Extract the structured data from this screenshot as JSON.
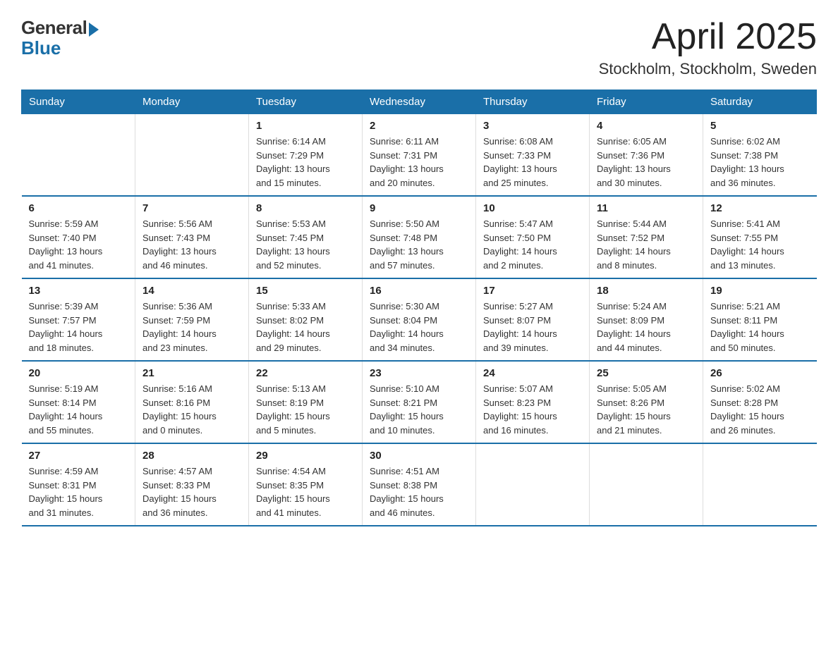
{
  "header": {
    "logo_general": "General",
    "logo_blue": "Blue",
    "month_title": "April 2025",
    "location": "Stockholm, Stockholm, Sweden"
  },
  "days_of_week": [
    "Sunday",
    "Monday",
    "Tuesday",
    "Wednesday",
    "Thursday",
    "Friday",
    "Saturday"
  ],
  "weeks": [
    [
      {
        "day": "",
        "info": ""
      },
      {
        "day": "",
        "info": ""
      },
      {
        "day": "1",
        "info": "Sunrise: 6:14 AM\nSunset: 7:29 PM\nDaylight: 13 hours\nand 15 minutes."
      },
      {
        "day": "2",
        "info": "Sunrise: 6:11 AM\nSunset: 7:31 PM\nDaylight: 13 hours\nand 20 minutes."
      },
      {
        "day": "3",
        "info": "Sunrise: 6:08 AM\nSunset: 7:33 PM\nDaylight: 13 hours\nand 25 minutes."
      },
      {
        "day": "4",
        "info": "Sunrise: 6:05 AM\nSunset: 7:36 PM\nDaylight: 13 hours\nand 30 minutes."
      },
      {
        "day": "5",
        "info": "Sunrise: 6:02 AM\nSunset: 7:38 PM\nDaylight: 13 hours\nand 36 minutes."
      }
    ],
    [
      {
        "day": "6",
        "info": "Sunrise: 5:59 AM\nSunset: 7:40 PM\nDaylight: 13 hours\nand 41 minutes."
      },
      {
        "day": "7",
        "info": "Sunrise: 5:56 AM\nSunset: 7:43 PM\nDaylight: 13 hours\nand 46 minutes."
      },
      {
        "day": "8",
        "info": "Sunrise: 5:53 AM\nSunset: 7:45 PM\nDaylight: 13 hours\nand 52 minutes."
      },
      {
        "day": "9",
        "info": "Sunrise: 5:50 AM\nSunset: 7:48 PM\nDaylight: 13 hours\nand 57 minutes."
      },
      {
        "day": "10",
        "info": "Sunrise: 5:47 AM\nSunset: 7:50 PM\nDaylight: 14 hours\nand 2 minutes."
      },
      {
        "day": "11",
        "info": "Sunrise: 5:44 AM\nSunset: 7:52 PM\nDaylight: 14 hours\nand 8 minutes."
      },
      {
        "day": "12",
        "info": "Sunrise: 5:41 AM\nSunset: 7:55 PM\nDaylight: 14 hours\nand 13 minutes."
      }
    ],
    [
      {
        "day": "13",
        "info": "Sunrise: 5:39 AM\nSunset: 7:57 PM\nDaylight: 14 hours\nand 18 minutes."
      },
      {
        "day": "14",
        "info": "Sunrise: 5:36 AM\nSunset: 7:59 PM\nDaylight: 14 hours\nand 23 minutes."
      },
      {
        "day": "15",
        "info": "Sunrise: 5:33 AM\nSunset: 8:02 PM\nDaylight: 14 hours\nand 29 minutes."
      },
      {
        "day": "16",
        "info": "Sunrise: 5:30 AM\nSunset: 8:04 PM\nDaylight: 14 hours\nand 34 minutes."
      },
      {
        "day": "17",
        "info": "Sunrise: 5:27 AM\nSunset: 8:07 PM\nDaylight: 14 hours\nand 39 minutes."
      },
      {
        "day": "18",
        "info": "Sunrise: 5:24 AM\nSunset: 8:09 PM\nDaylight: 14 hours\nand 44 minutes."
      },
      {
        "day": "19",
        "info": "Sunrise: 5:21 AM\nSunset: 8:11 PM\nDaylight: 14 hours\nand 50 minutes."
      }
    ],
    [
      {
        "day": "20",
        "info": "Sunrise: 5:19 AM\nSunset: 8:14 PM\nDaylight: 14 hours\nand 55 minutes."
      },
      {
        "day": "21",
        "info": "Sunrise: 5:16 AM\nSunset: 8:16 PM\nDaylight: 15 hours\nand 0 minutes."
      },
      {
        "day": "22",
        "info": "Sunrise: 5:13 AM\nSunset: 8:19 PM\nDaylight: 15 hours\nand 5 minutes."
      },
      {
        "day": "23",
        "info": "Sunrise: 5:10 AM\nSunset: 8:21 PM\nDaylight: 15 hours\nand 10 minutes."
      },
      {
        "day": "24",
        "info": "Sunrise: 5:07 AM\nSunset: 8:23 PM\nDaylight: 15 hours\nand 16 minutes."
      },
      {
        "day": "25",
        "info": "Sunrise: 5:05 AM\nSunset: 8:26 PM\nDaylight: 15 hours\nand 21 minutes."
      },
      {
        "day": "26",
        "info": "Sunrise: 5:02 AM\nSunset: 8:28 PM\nDaylight: 15 hours\nand 26 minutes."
      }
    ],
    [
      {
        "day": "27",
        "info": "Sunrise: 4:59 AM\nSunset: 8:31 PM\nDaylight: 15 hours\nand 31 minutes."
      },
      {
        "day": "28",
        "info": "Sunrise: 4:57 AM\nSunset: 8:33 PM\nDaylight: 15 hours\nand 36 minutes."
      },
      {
        "day": "29",
        "info": "Sunrise: 4:54 AM\nSunset: 8:35 PM\nDaylight: 15 hours\nand 41 minutes."
      },
      {
        "day": "30",
        "info": "Sunrise: 4:51 AM\nSunset: 8:38 PM\nDaylight: 15 hours\nand 46 minutes."
      },
      {
        "day": "",
        "info": ""
      },
      {
        "day": "",
        "info": ""
      },
      {
        "day": "",
        "info": ""
      }
    ]
  ]
}
